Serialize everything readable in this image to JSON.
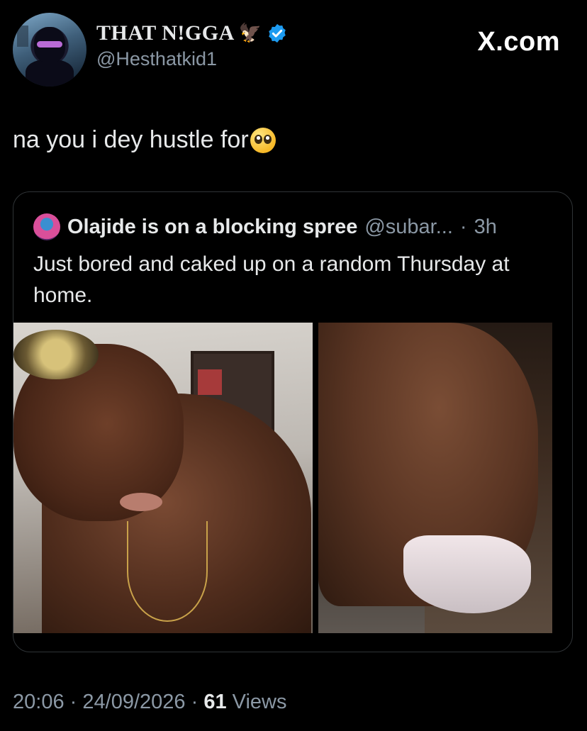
{
  "author": {
    "display_name": "THAT N!GGA",
    "handle": "@Hesthatkid1",
    "icons": [
      "eagle-emoji",
      "verified-badge-icon"
    ]
  },
  "brand": "X.com",
  "tweet": {
    "text": "na you i dey hustle for",
    "emoji": "pleading-face-emoji"
  },
  "quoted": {
    "display_name": "Olajide is on a blocking spree",
    "handle": "@subar...",
    "separator": "·",
    "time": "3h",
    "text": "Just bored and caked up on a random Thursday at home.",
    "photos": [
      "selfie-photo",
      "back-photo"
    ]
  },
  "footer": {
    "time": "20:06",
    "date": "24/09/2026",
    "views_count": "61",
    "views_label": "Views",
    "separator": "·"
  },
  "colors": {
    "background": "#000000",
    "text": "#e7e9ea",
    "muted": "#8b98a5",
    "border": "#2f3336",
    "verified": "#1d9bf0"
  }
}
